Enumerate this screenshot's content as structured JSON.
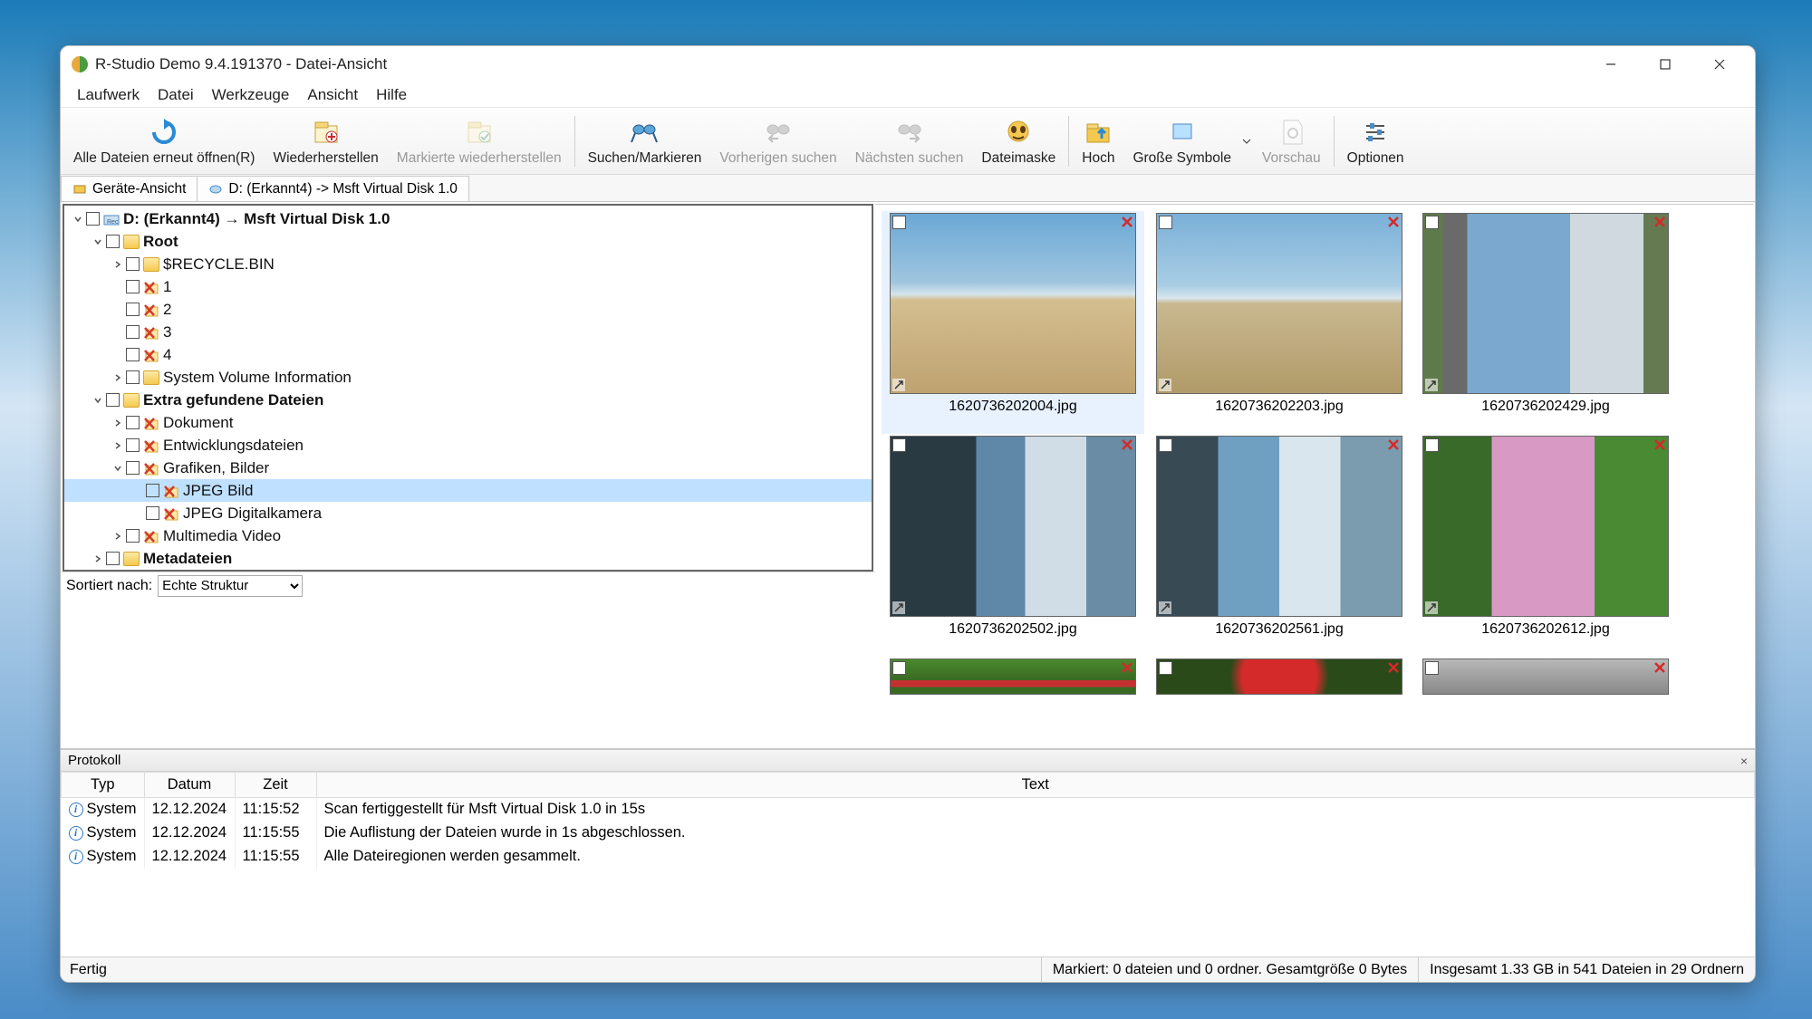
{
  "title": "R-Studio Demo 9.4.191370 - Datei-Ansicht",
  "menu": [
    "Laufwerk",
    "Datei",
    "Werkzeuge",
    "Ansicht",
    "Hilfe"
  ],
  "toolbar": [
    {
      "id": "reopen",
      "label": "Alle Dateien erneut öffnen(R)",
      "disabled": false
    },
    {
      "id": "restore",
      "label": "Wiederherstellen",
      "disabled": false
    },
    {
      "id": "restore-marked",
      "label": "Markierte wiederherstellen",
      "disabled": true
    },
    {
      "id": "search",
      "label": "Suchen/Markieren",
      "disabled": false
    },
    {
      "id": "search-prev",
      "label": "Vorherigen suchen",
      "disabled": true
    },
    {
      "id": "search-next",
      "label": "Nächsten suchen",
      "disabled": true
    },
    {
      "id": "filemask",
      "label": "Dateimaske",
      "disabled": false
    },
    {
      "id": "up",
      "label": "Hoch",
      "disabled": false
    },
    {
      "id": "large-icons",
      "label": "Große Symbole",
      "disabled": false,
      "dropdown": true
    },
    {
      "id": "preview",
      "label": "Vorschau",
      "disabled": true
    },
    {
      "id": "options",
      "label": "Optionen",
      "disabled": false
    }
  ],
  "tabs": [
    {
      "id": "device-view",
      "label": "Geräte-Ansicht",
      "active": false
    },
    {
      "id": "disk-view",
      "label": "D: (Erkannt4) -> Msft Virtual Disk 1.0",
      "active": true
    }
  ],
  "tree": [
    {
      "depth": 0,
      "expander": "down",
      "bold": true,
      "icon": "disk",
      "label": "D: (Erkannt4) → Msft Virtual Disk 1.0"
    },
    {
      "depth": 1,
      "expander": "down",
      "bold": true,
      "icon": "folder",
      "label": "Root"
    },
    {
      "depth": 2,
      "expander": "right",
      "bold": false,
      "icon": "folder",
      "label": "$RECYCLE.BIN"
    },
    {
      "depth": 2,
      "expander": "",
      "bold": false,
      "icon": "x",
      "label": "1"
    },
    {
      "depth": 2,
      "expander": "",
      "bold": false,
      "icon": "x",
      "label": "2"
    },
    {
      "depth": 2,
      "expander": "",
      "bold": false,
      "icon": "x",
      "label": "3"
    },
    {
      "depth": 2,
      "expander": "",
      "bold": false,
      "icon": "x",
      "label": "4"
    },
    {
      "depth": 2,
      "expander": "right",
      "bold": false,
      "icon": "folder",
      "label": "System Volume Information"
    },
    {
      "depth": 1,
      "expander": "down",
      "bold": true,
      "icon": "folder",
      "label": "Extra gefundene Dateien"
    },
    {
      "depth": 2,
      "expander": "right",
      "bold": false,
      "icon": "x",
      "label": "Dokument"
    },
    {
      "depth": 2,
      "expander": "right",
      "bold": false,
      "icon": "x",
      "label": "Entwicklungsdateien"
    },
    {
      "depth": 2,
      "expander": "down",
      "bold": false,
      "icon": "x",
      "label": "Grafiken, Bilder"
    },
    {
      "depth": 3,
      "expander": "",
      "bold": false,
      "icon": "x",
      "label": "JPEG Bild",
      "selected": true
    },
    {
      "depth": 3,
      "expander": "",
      "bold": false,
      "icon": "x",
      "label": "JPEG Digitalkamera"
    },
    {
      "depth": 2,
      "expander": "right",
      "bold": false,
      "icon": "x",
      "label": "Multimedia Video"
    },
    {
      "depth": 1,
      "expander": "right",
      "bold": true,
      "icon": "folder",
      "label": "Metadateien"
    }
  ],
  "sort": {
    "label": "Sortiert nach:",
    "value": "Echte Struktur"
  },
  "thumbs": [
    {
      "name": "1620736202004.jpg",
      "cls": "img-beach1",
      "selected": true
    },
    {
      "name": "1620736202203.jpg",
      "cls": "img-beach2"
    },
    {
      "name": "1620736202429.jpg",
      "cls": "img-road"
    },
    {
      "name": "1620736202502.jpg",
      "cls": "img-clouds1"
    },
    {
      "name": "1620736202561.jpg",
      "cls": "img-clouds2"
    },
    {
      "name": "1620736202612.jpg",
      "cls": "img-blossom"
    },
    {
      "name": "",
      "cls": "img-green1",
      "partial": true
    },
    {
      "name": "",
      "cls": "img-flower",
      "partial": true
    },
    {
      "name": "",
      "cls": "img-grey",
      "partial": true
    }
  ],
  "protocol": {
    "title": "Protokoll",
    "headers": [
      "Typ",
      "Datum",
      "Zeit",
      "Text"
    ],
    "rows": [
      {
        "typ": "System",
        "datum": "12.12.2024",
        "zeit": "11:15:52",
        "text": "Scan fertiggestellt für Msft Virtual Disk 1.0 in 15s"
      },
      {
        "typ": "System",
        "datum": "12.12.2024",
        "zeit": "11:15:55",
        "text": "Die Auflistung der Dateien wurde in 1s abgeschlossen."
      },
      {
        "typ": "System",
        "datum": "12.12.2024",
        "zeit": "11:15:55",
        "text": "Alle Dateiregionen werden gesammelt."
      }
    ]
  },
  "status": {
    "left": "Fertig",
    "marked": "Markiert: 0 dateien und 0 ordner. Gesamtgröße 0 Bytes",
    "total": "Insgesamt 1.33 GB in 541 Dateien in 29 Ordnern"
  }
}
